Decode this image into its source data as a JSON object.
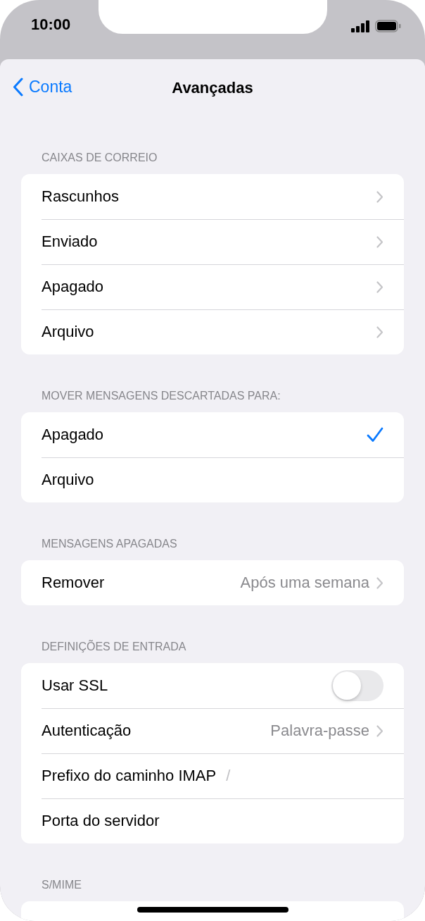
{
  "status_bar": {
    "time": "10:00"
  },
  "nav": {
    "back": "Conta",
    "title": "Avançadas"
  },
  "sections": [
    {
      "header": "CAIXAS DE CORREIO",
      "rows": [
        {
          "kind": "nav",
          "label": "Rascunhos"
        },
        {
          "kind": "nav",
          "label": "Enviado"
        },
        {
          "kind": "nav",
          "label": "Apagado"
        },
        {
          "kind": "nav",
          "label": "Arquivo"
        }
      ]
    },
    {
      "header": "MOVER MENSAGENS DESCARTADAS PARA:",
      "rows": [
        {
          "kind": "check",
          "label": "Apagado",
          "selected": true
        },
        {
          "kind": "check",
          "label": "Arquivo",
          "selected": false
        }
      ]
    },
    {
      "header": "MENSAGENS APAGADAS",
      "rows": [
        {
          "kind": "nav",
          "label": "Remover",
          "value": "Após uma semana"
        }
      ]
    },
    {
      "header": "DEFINIÇÕES DE ENTRADA",
      "rows": [
        {
          "kind": "toggle",
          "label": "Usar SSL",
          "on": false
        },
        {
          "kind": "nav",
          "label": "Autenticação",
          "value": "Palavra-passe"
        },
        {
          "kind": "field",
          "label": "Prefixo do caminho IMAP",
          "value": "/"
        },
        {
          "kind": "field",
          "label": "Porta do servidor"
        }
      ]
    },
    {
      "header": "S/MIME"
    }
  ]
}
